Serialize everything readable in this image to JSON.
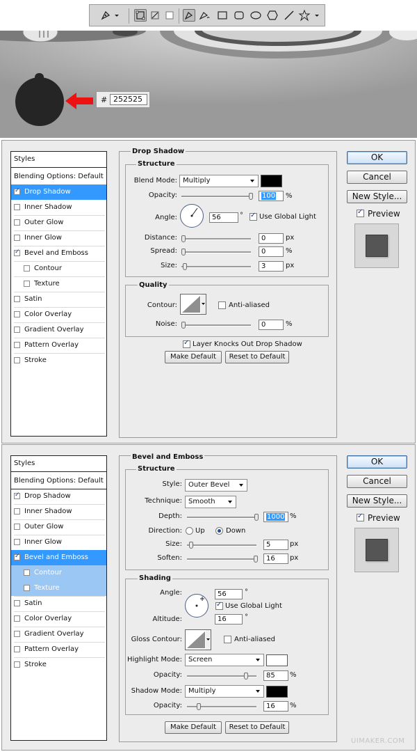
{
  "toolbar": {
    "tools": [
      "pen-tool-icon",
      "chevron-down-icon",
      "shape-layers-icon",
      "paths-icon",
      "fill-pixels-icon",
      "pen-icon",
      "freeform-pen-icon",
      "rectangle-icon",
      "rounded-rectangle-icon",
      "ellipse-icon",
      "polygon-icon",
      "line-icon",
      "custom-shape-icon",
      "chevron-down-icon"
    ]
  },
  "canvas": {
    "hex_prefix": "#",
    "hex_value": "252525",
    "circle_color": "#252525",
    "arrow_color": "#ee1111"
  },
  "dialog1": {
    "styles_header": "Styles",
    "blending_options": "Blending Options: Default",
    "items": [
      {
        "label": "Drop Shadow",
        "checked": true,
        "selected": true
      },
      {
        "label": "Inner Shadow",
        "checked": false
      },
      {
        "label": "Outer Glow",
        "checked": false
      },
      {
        "label": "Inner Glow",
        "checked": false
      },
      {
        "label": "Bevel and Emboss",
        "checked": true
      },
      {
        "label": "Contour",
        "checked": false
      },
      {
        "label": "Texture",
        "checked": false
      },
      {
        "label": "Satin",
        "checked": false
      },
      {
        "label": "Color Overlay",
        "checked": false
      },
      {
        "label": "Gradient Overlay",
        "checked": false
      },
      {
        "label": "Pattern Overlay",
        "checked": false
      },
      {
        "label": "Stroke",
        "checked": false
      }
    ],
    "title": "Drop Shadow",
    "structure": "Structure",
    "blend_mode_label": "Blend Mode:",
    "blend_mode": "Multiply",
    "opacity_label": "Opacity:",
    "opacity": "100",
    "pct": "%",
    "angle_label": "Angle:",
    "angle": "56",
    "deg": "°",
    "use_global_light": "Use Global Light",
    "distance_label": "Distance:",
    "distance": "0",
    "spread_label": "Spread:",
    "spread": "0",
    "size_label": "Size:",
    "size": "3",
    "px": "px",
    "quality": "Quality",
    "contour_label": "Contour:",
    "anti_aliased": "Anti-aliased",
    "noise_label": "Noise:",
    "noise": "0",
    "layer_knocks_out": "Layer Knocks Out Drop Shadow",
    "make_default": "Make Default",
    "reset_to_default": "Reset to Default",
    "ok": "OK",
    "cancel": "Cancel",
    "new_style": "New Style...",
    "preview": "Preview"
  },
  "dialog2": {
    "styles_header": "Styles",
    "blending_options": "Blending Options: Default",
    "items": [
      {
        "label": "Drop Shadow",
        "checked": true
      },
      {
        "label": "Inner Shadow",
        "checked": false
      },
      {
        "label": "Outer Glow",
        "checked": false
      },
      {
        "label": "Inner Glow",
        "checked": false
      },
      {
        "label": "Bevel and Emboss",
        "checked": true,
        "selected": true
      },
      {
        "label": "Contour",
        "checked": false
      },
      {
        "label": "Texture",
        "checked": false
      },
      {
        "label": "Satin",
        "checked": false
      },
      {
        "label": "Color Overlay",
        "checked": false
      },
      {
        "label": "Gradient Overlay",
        "checked": false
      },
      {
        "label": "Pattern Overlay",
        "checked": false
      },
      {
        "label": "Stroke",
        "checked": false
      }
    ],
    "title": "Bevel and Emboss",
    "structure": "Structure",
    "style_label": "Style:",
    "style": "Outer Bevel",
    "technique_label": "Technique:",
    "technique": "Smooth",
    "depth_label": "Depth:",
    "depth": "1000",
    "pct": "%",
    "direction_label": "Direction:",
    "up": "Up",
    "down": "Down",
    "size_label": "Size:",
    "size": "5",
    "px": "px",
    "soften_label": "Soften:",
    "soften": "16",
    "shading": "Shading",
    "angle_label": "Angle:",
    "angle": "56",
    "deg": "°",
    "use_global_light": "Use Global Light",
    "altitude_label": "Altitude:",
    "altitude": "16",
    "gloss_contour_label": "Gloss Contour:",
    "anti_aliased": "Anti-aliased",
    "highlight_mode_label": "Highlight Mode:",
    "highlight_mode": "Screen",
    "highlight_opacity_label": "Opacity:",
    "highlight_opacity": "85",
    "shadow_mode_label": "Shadow Mode:",
    "shadow_mode": "Multiply",
    "shadow_opacity_label": "Opacity:",
    "shadow_opacity": "16",
    "make_default": "Make Default",
    "reset_to_default": "Reset to Default",
    "ok": "OK",
    "cancel": "Cancel",
    "new_style": "New Style...",
    "preview": "Preview"
  },
  "watermark": "UIMAKER.COM"
}
